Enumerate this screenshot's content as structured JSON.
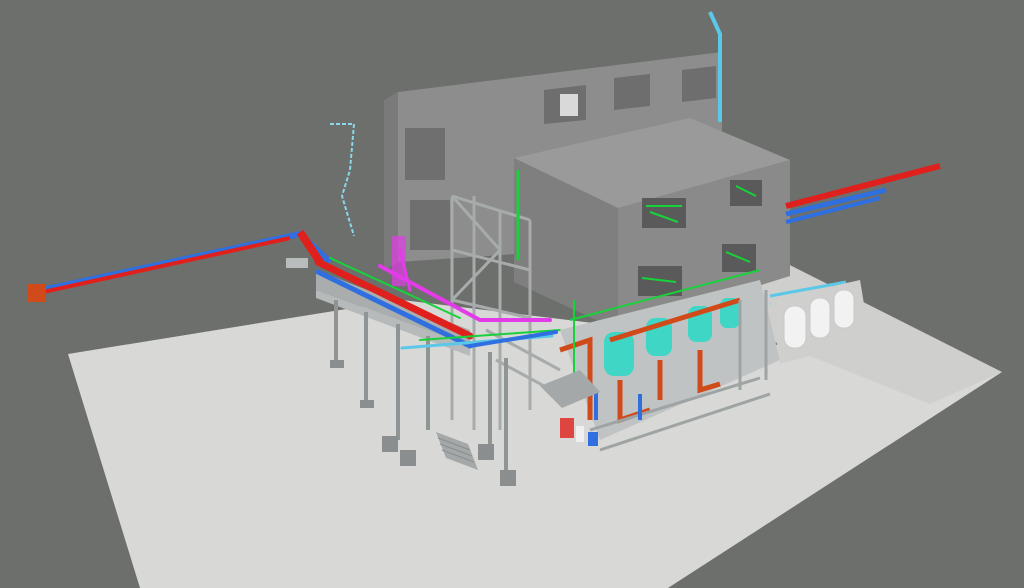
{
  "scene": {
    "type": "3d-plant-model-isometric-view",
    "colors": {
      "viewport_background": "#6c6f6b",
      "ground_slab": "#d8d8d6",
      "building_wall": "#8f8f8f",
      "structural_steel": "#9ea3a3",
      "pipe_hot_red": "#e0201c",
      "pipe_cold_blue": "#2f6fe0",
      "pipe_cyan": "#5cc8e8",
      "pipe_green": "#18d23a",
      "pipe_magenta": "#e23ce8",
      "vessel_teal": "#3fd6c6",
      "tank_white": "#f2f2f2",
      "valve_orange": "#d04a1a"
    }
  }
}
